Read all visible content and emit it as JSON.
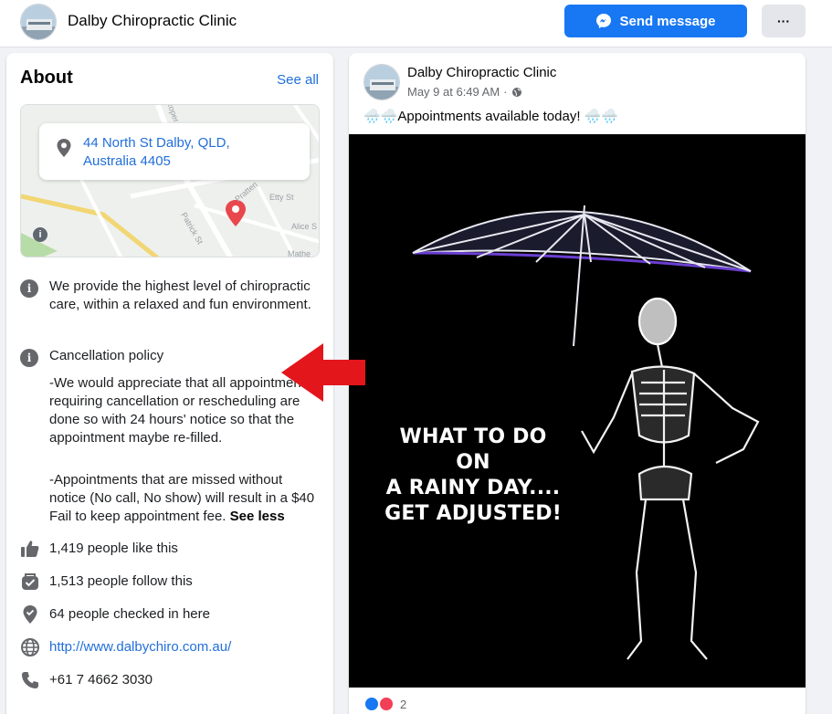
{
  "header": {
    "page_name": "Dalby Chiropractic Clinic",
    "send_message_label": "Send message",
    "more_label": "···"
  },
  "about": {
    "title": "About",
    "see_all": "See all",
    "address": "44 North St Dalby, QLD, Australia 4405",
    "map_labels": [
      "Etty St",
      "Alice S",
      "Patrick St",
      "Pratten",
      "Mathe",
      "Roper"
    ],
    "description": "We provide the highest level of chiropractic care, within a relaxed and fun environment.",
    "cancellation_title": "Cancellation policy",
    "cancellation_p1": "-We would appreciate that all appointments requiring cancellation or rescheduling are done so with 24 hours' notice so that the appointment maybe re-filled.",
    "cancellation_p2": "-Appointments that are missed without notice (No call, No show) will result in a $40 Fail to keep appointment fee.",
    "see_less": "See less",
    "likes": "1,419 people like this",
    "follows": "1,513 people follow this",
    "checkins": "64 people checked in here",
    "website": "http://www.dalbychiro.com.au/",
    "phone": "+61 7 4662 3030"
  },
  "post": {
    "author": "Dalby Chiropractic Clinic",
    "timestamp": "May 9 at 6:49 AM",
    "separator": "·",
    "text": "🌧️🌧️Appointments available today! 🌧️🌧️",
    "image_caption_line1": "WHAT TO DO ON",
    "image_caption_line2": "A RAINY DAY....",
    "image_caption_line3": "GET ADJUSTED!",
    "reaction_count": "2"
  },
  "colors": {
    "brand_blue": "#1877f2",
    "link_blue": "#216fdb",
    "annotation_red": "#e3161c",
    "map_pin_red": "#e8474c"
  }
}
